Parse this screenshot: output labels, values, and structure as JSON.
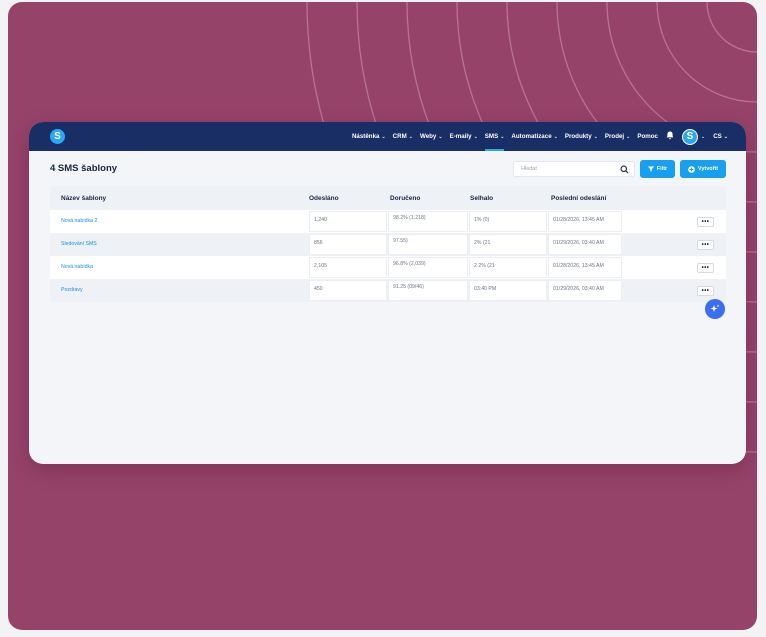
{
  "nav": {
    "logo_letter": "S",
    "items": [
      {
        "label": "Nástěnka"
      },
      {
        "label": "CRM"
      },
      {
        "label": "Weby"
      },
      {
        "label": "E-maily"
      },
      {
        "label": "SMS"
      },
      {
        "label": "Automatizace"
      },
      {
        "label": "Produkty"
      },
      {
        "label": "Prodej"
      }
    ],
    "help_label": "Pomoc",
    "avatar_letter": "S",
    "language": "CS"
  },
  "page": {
    "title": "4 SMS šablony",
    "search_placeholder": "Hledat",
    "filter_label": "Filtr",
    "create_label": "Vytvořit"
  },
  "table": {
    "headers": {
      "name": "Název šablony",
      "sent": "Odesláno",
      "delivered": "Doručeno",
      "failed": "Selhalo",
      "last_sent": "Poslední odeslání"
    },
    "rows": [
      {
        "name": "Nová nabídka 2",
        "sent": "1,240",
        "delivered": "98.2% (1,218)",
        "failed": "1% (0)",
        "last_sent": "01/28/2026, 13:45 AM"
      },
      {
        "name": "Sledování SMS",
        "sent": "856",
        "delivered": "97.55)",
        "failed": "2% (21",
        "last_sent": "01/29/2026, 03:40 AM"
      },
      {
        "name": "Nová nabídka",
        "sent": "2,105",
        "delivered": "96.8% (2,039)",
        "failed": "2.2% (21",
        "last_sent": "01/28/2026, 13:45 AM"
      },
      {
        "name": "Pozdravy",
        "sent": "450",
        "delivered": "91.25 (09/46)",
        "failed": "03:40 PM",
        "last_sent": "01/29/2026, 03:40 AM"
      }
    ],
    "more_label": "•••"
  },
  "colors": {
    "background": "#96436a",
    "navbar": "#1a2e66",
    "accent": "#18a0f0",
    "link": "#1a8fe3"
  }
}
